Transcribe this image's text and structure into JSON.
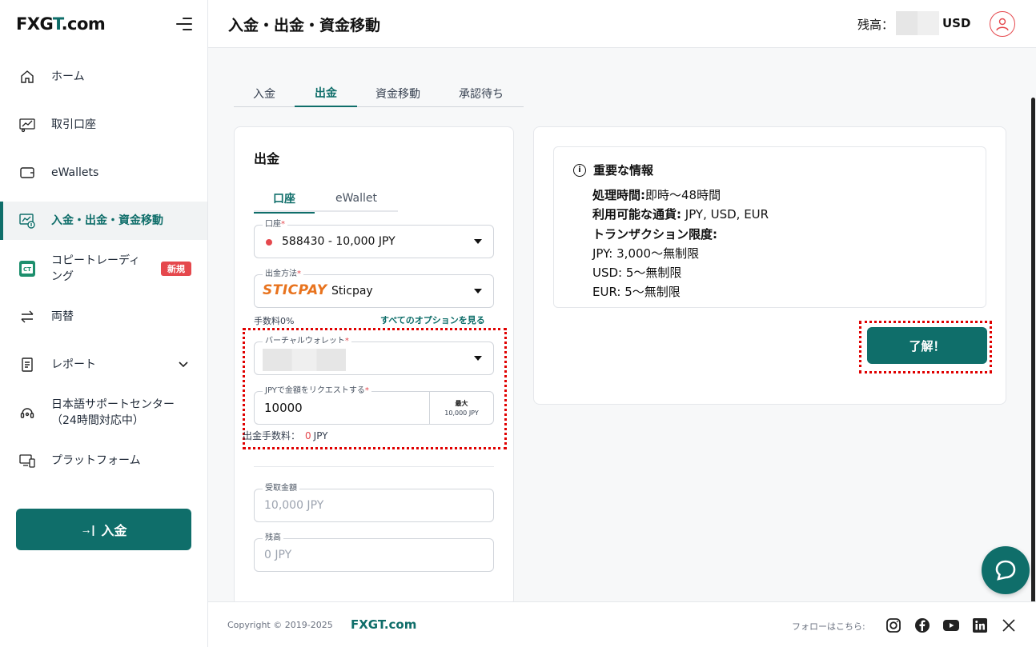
{
  "logo": {
    "fx": "FX",
    "g": "G",
    "t": "T",
    "com": ".com"
  },
  "sidebar": {
    "items": [
      {
        "label": "ホーム",
        "icon": "home-icon"
      },
      {
        "label": "取引口座",
        "icon": "trading-account-icon"
      },
      {
        "label": "eWallets",
        "icon": "wallet-icon"
      },
      {
        "label": "入金・出金・資金移動",
        "icon": "deposit-withdraw-icon"
      },
      {
        "label": "コピートレーディング",
        "icon": "copy-trading-icon",
        "badge": "新規"
      },
      {
        "label": "両替",
        "icon": "exchange-icon"
      },
      {
        "label": "レポート",
        "icon": "report-icon"
      },
      {
        "label": "日本語サポートセンター（24時間対応中）",
        "icon": "support-icon"
      },
      {
        "label": "プラットフォーム",
        "icon": "platform-icon"
      }
    ],
    "deposit_button": "入金"
  },
  "header": {
    "title": "入金・出金・資金移動",
    "balance_label": "残高：",
    "balance_currency": "USD"
  },
  "tabs": [
    "入金",
    "出金",
    "資金移動",
    "承認待ち"
  ],
  "withdraw": {
    "title": "出金",
    "subtabs": [
      "口座",
      "eWallet"
    ],
    "account_label": "口座",
    "account_value": "588430 - 10,000 JPY",
    "method_label": "出金方法",
    "method_logo": "STICPAY",
    "method_value": "Sticpay",
    "fee_text": "手数料0%",
    "all_options": "すべてのオプションを見る",
    "virtual_wallet_label": "バーチャルウォレット",
    "amount_label": "JPYで金額をリクエストする",
    "amount_value": "10000",
    "max_label": "最大",
    "max_value": "10,000 JPY",
    "withdraw_fee_label": "出金手数料：",
    "withdraw_fee_value": "0",
    "withdraw_fee_unit": "JPY",
    "received_label": "受取金額",
    "received_value": "10,000 JPY",
    "remaining_label": "残高",
    "remaining_value": "0 JPY"
  },
  "info": {
    "heading": "重要な情報",
    "processing_label": "処理時間:",
    "processing_value": "即時〜48時間",
    "currencies_label": "利用可能な通貨:",
    "currencies_value": " JPY, USD, EUR",
    "limits_label": "トランザクション限度:",
    "limit_jpy": "JPY: 3,000〜無制限",
    "limit_usd": "USD: 5〜無制限",
    "limit_eur": "EUR: 5〜無制限",
    "ok_button": "了解！"
  },
  "footer": {
    "copyright": "Copyright © 2019-2025",
    "brand": "FXGT.com",
    "follow": "フォローはこちら:",
    "socials": [
      "instagram-icon",
      "facebook-icon",
      "youtube-icon",
      "linkedin-icon",
      "x-icon"
    ]
  },
  "colors": {
    "accent": "#0f6e6a",
    "danger": "#e5484d",
    "highlight": "#e00000"
  }
}
